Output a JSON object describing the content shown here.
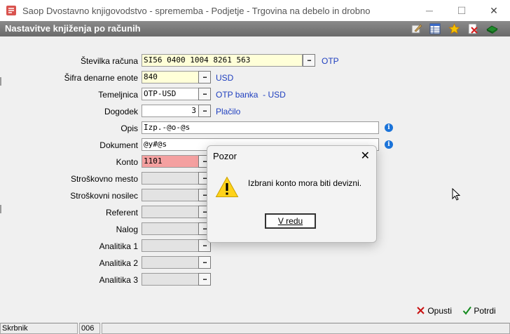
{
  "window": {
    "title": "Saop Dvostavno knjigovodstvo - sprememba - Podjetje - Trgovina na debelo in drobno",
    "minimize": "─",
    "maximize": "☐",
    "close": "✕"
  },
  "form": {
    "title": "Nastavitve knjiženja po računih",
    "toolbar_icons": [
      "edit-icon",
      "table-icon",
      "star-icon",
      "delete-icon",
      "exit-icon"
    ],
    "fields": {
      "stevilka_racuna": {
        "label": "Številka računa",
        "value": "SI56 0400 1004 8261 563",
        "side": "OTP"
      },
      "sifra_denarne_enote": {
        "label": "Šifra denarne enote",
        "value": "840",
        "side": "USD"
      },
      "temeljnica": {
        "label": "Temeljnica",
        "value": "OTP-USD",
        "side": "OTP banka  - USD"
      },
      "dogodek": {
        "label": "Dogodek",
        "value": "3",
        "side": "Plačilo"
      },
      "opis": {
        "label": "Opis",
        "value": "Izp.-@o-@s"
      },
      "dokument": {
        "label": "Dokument",
        "value": "@y#@s"
      },
      "konto": {
        "label": "Konto",
        "value": "1101"
      },
      "stroskovno_mesto": {
        "label": "Stroškovno mesto",
        "value": ""
      },
      "stroskovni_nosilec": {
        "label": "Stroškovni nosilec",
        "value": ""
      },
      "referent": {
        "label": "Referent",
        "value": ""
      },
      "nalog": {
        "label": "Nalog",
        "value": ""
      },
      "analitika1": {
        "label": "Analitika 1",
        "value": ""
      },
      "analitika2": {
        "label": "Analitika 2",
        "value": ""
      },
      "analitika3": {
        "label": "Analitika 3",
        "value": ""
      }
    },
    "ellipsis": "...",
    "info": "i"
  },
  "dialog": {
    "title": "Pozor",
    "message": "Izbrani konto mora biti devizni.",
    "ok_label": "V redu",
    "close": "✕"
  },
  "buttons": {
    "cancel_label": "Opusti",
    "confirm_label": "Potrdi"
  },
  "status": {
    "user": "Skrbnik",
    "code": "006"
  },
  "colors": {
    "required_field": "#ffffd8",
    "error_field": "#f4a0a0",
    "link_text": "#1f3fbf",
    "header_bar": "#7a7a7a"
  }
}
